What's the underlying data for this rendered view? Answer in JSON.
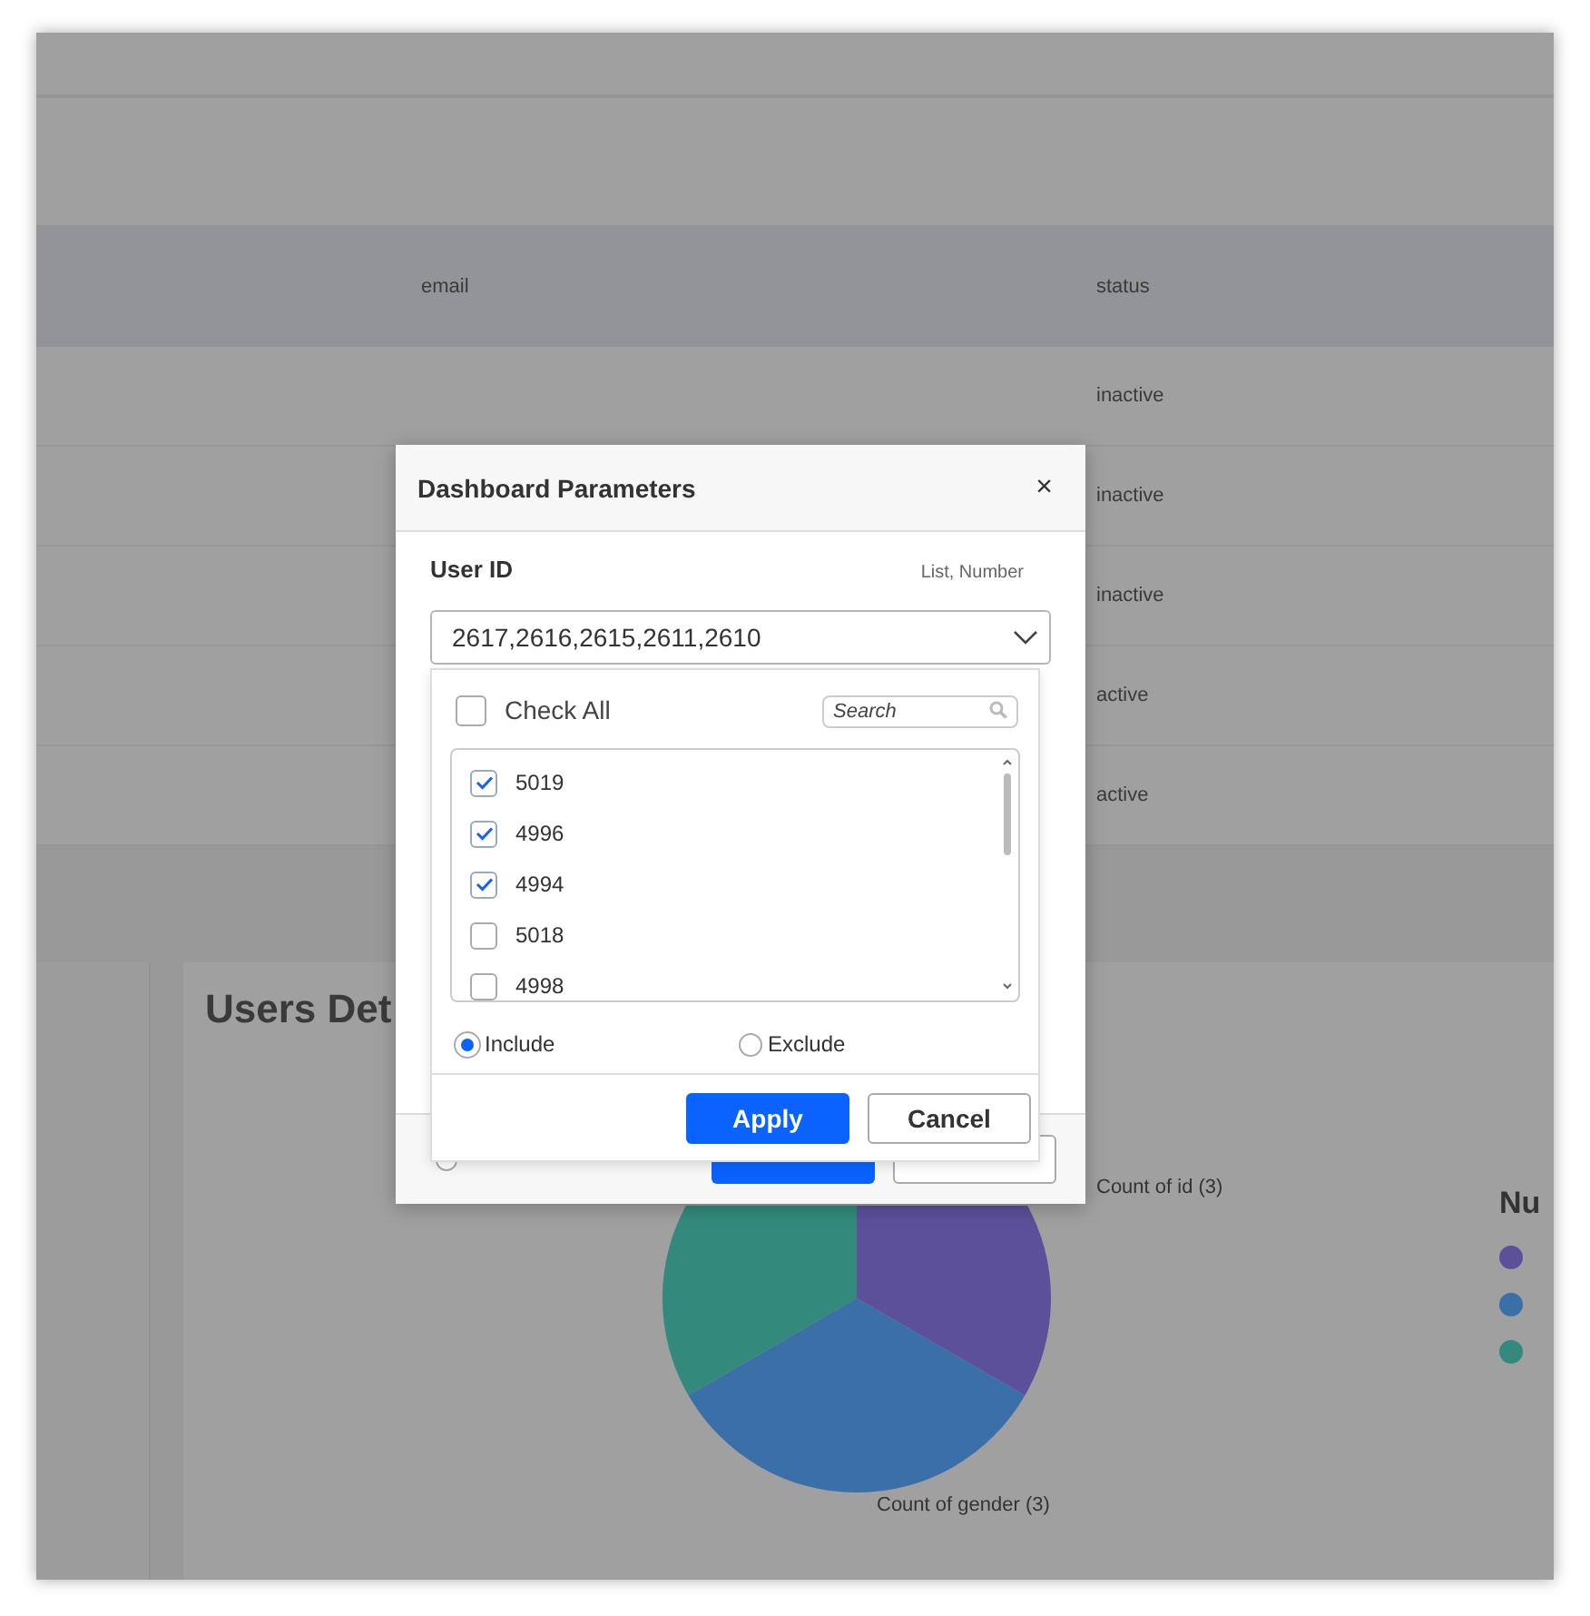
{
  "background": {
    "table": {
      "columns": [
        "email",
        "status"
      ],
      "rows": [
        {
          "status": "inactive"
        },
        {
          "status": "inactive"
        },
        {
          "status": "inactive"
        },
        {
          "status": "active"
        },
        {
          "status": "active"
        }
      ]
    },
    "card": {
      "title": "Users Det",
      "chart_labels": [
        "Count of id (3)",
        "Count of gender (3)"
      ],
      "legend": {
        "title": "Nu",
        "items": [
          {
            "color": "#5c509a"
          },
          {
            "color": "#3a6fa8"
          },
          {
            "color": "#338a7c"
          }
        ]
      }
    },
    "dialog_footer": {
      "radio": {
        "selected": false
      }
    }
  },
  "dialog": {
    "title": "Dashboard Parameters",
    "close": "×",
    "parameter": {
      "label": "User ID",
      "type": "List, Number",
      "value": "2617,2616,2615,2611,2610"
    },
    "dropdown": {
      "check_all": {
        "label": "Check All",
        "checked": false
      },
      "search": {
        "placeholder": "Search"
      },
      "items": [
        {
          "label": "5019",
          "checked": true
        },
        {
          "label": "4996",
          "checked": true
        },
        {
          "label": "4994",
          "checked": true
        },
        {
          "label": "5018",
          "checked": false
        },
        {
          "label": "4998",
          "checked": false
        }
      ],
      "modes": [
        {
          "label": "Include",
          "selected": true
        },
        {
          "label": "Exclude",
          "selected": false
        }
      ],
      "buttons": [
        "Apply",
        "Cancel"
      ]
    }
  }
}
